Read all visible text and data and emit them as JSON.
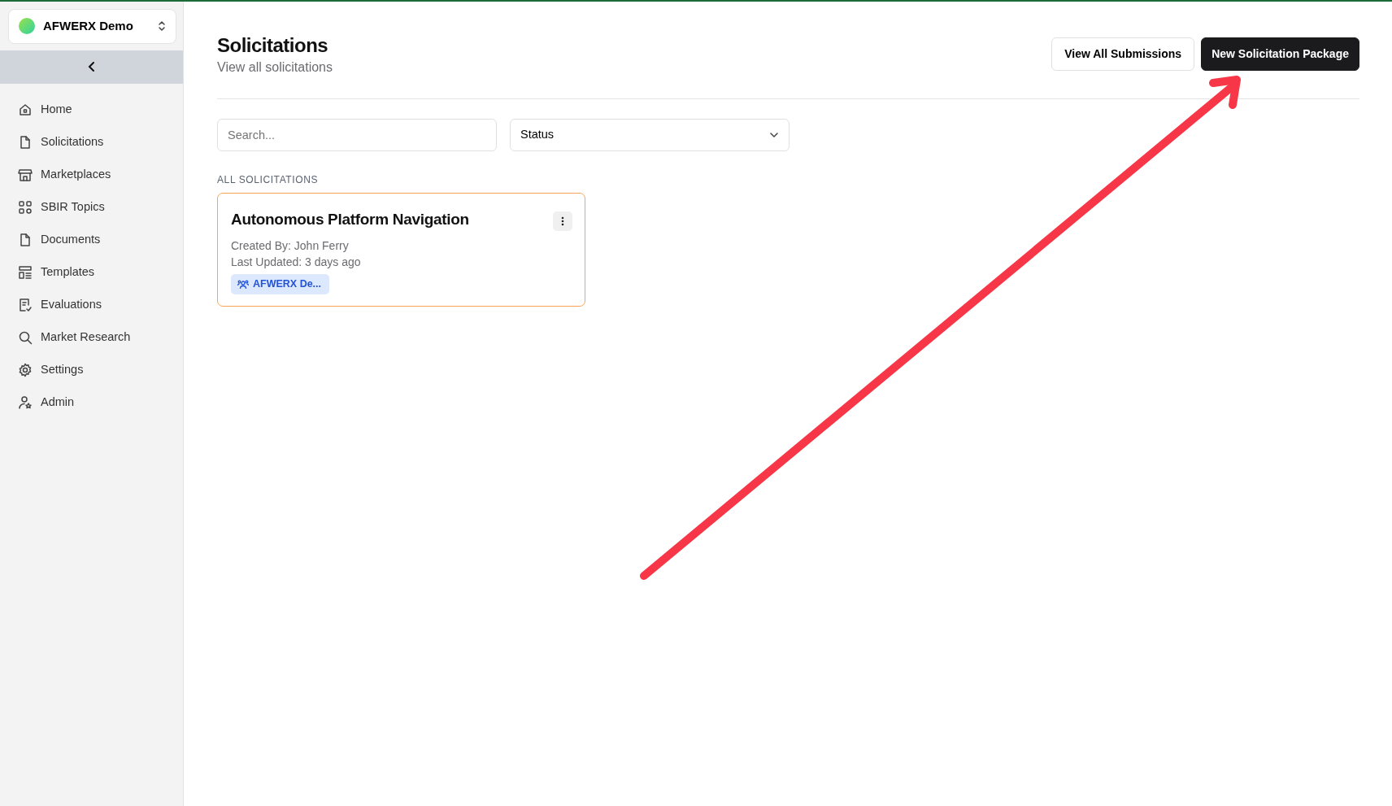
{
  "workspace": {
    "name": "AFWERX Demo"
  },
  "sidebar": {
    "items": [
      {
        "label": "Home",
        "kind": "home"
      },
      {
        "label": "Solicitations",
        "kind": "file"
      },
      {
        "label": "Marketplaces",
        "kind": "store"
      },
      {
        "label": "SBIR Topics",
        "kind": "grid"
      },
      {
        "label": "Documents",
        "kind": "file"
      },
      {
        "label": "Templates",
        "kind": "layout"
      },
      {
        "label": "Evaluations",
        "kind": "check"
      },
      {
        "label": "Market Research",
        "kind": "search"
      },
      {
        "label": "Settings",
        "kind": "gear"
      },
      {
        "label": "Admin",
        "kind": "admin"
      }
    ]
  },
  "header": {
    "title": "Solicitations",
    "subtitle": "View all solicitations",
    "buttons": [
      {
        "label": "View All Submissions",
        "kind": "outline"
      },
      {
        "label": "New Solicitation Package",
        "kind": "dark"
      }
    ]
  },
  "filters": {
    "search": {
      "placeholder": "Search..."
    },
    "status": {
      "value": "Status"
    }
  },
  "section_label": "ALL SOLICITATIONS",
  "cards": [
    {
      "title": "Autonomous Platform Navigation",
      "created_by": "Created By: John Ferry",
      "updated": "Last Updated: 3 days ago",
      "tag": "AFWERX De..."
    }
  ]
}
